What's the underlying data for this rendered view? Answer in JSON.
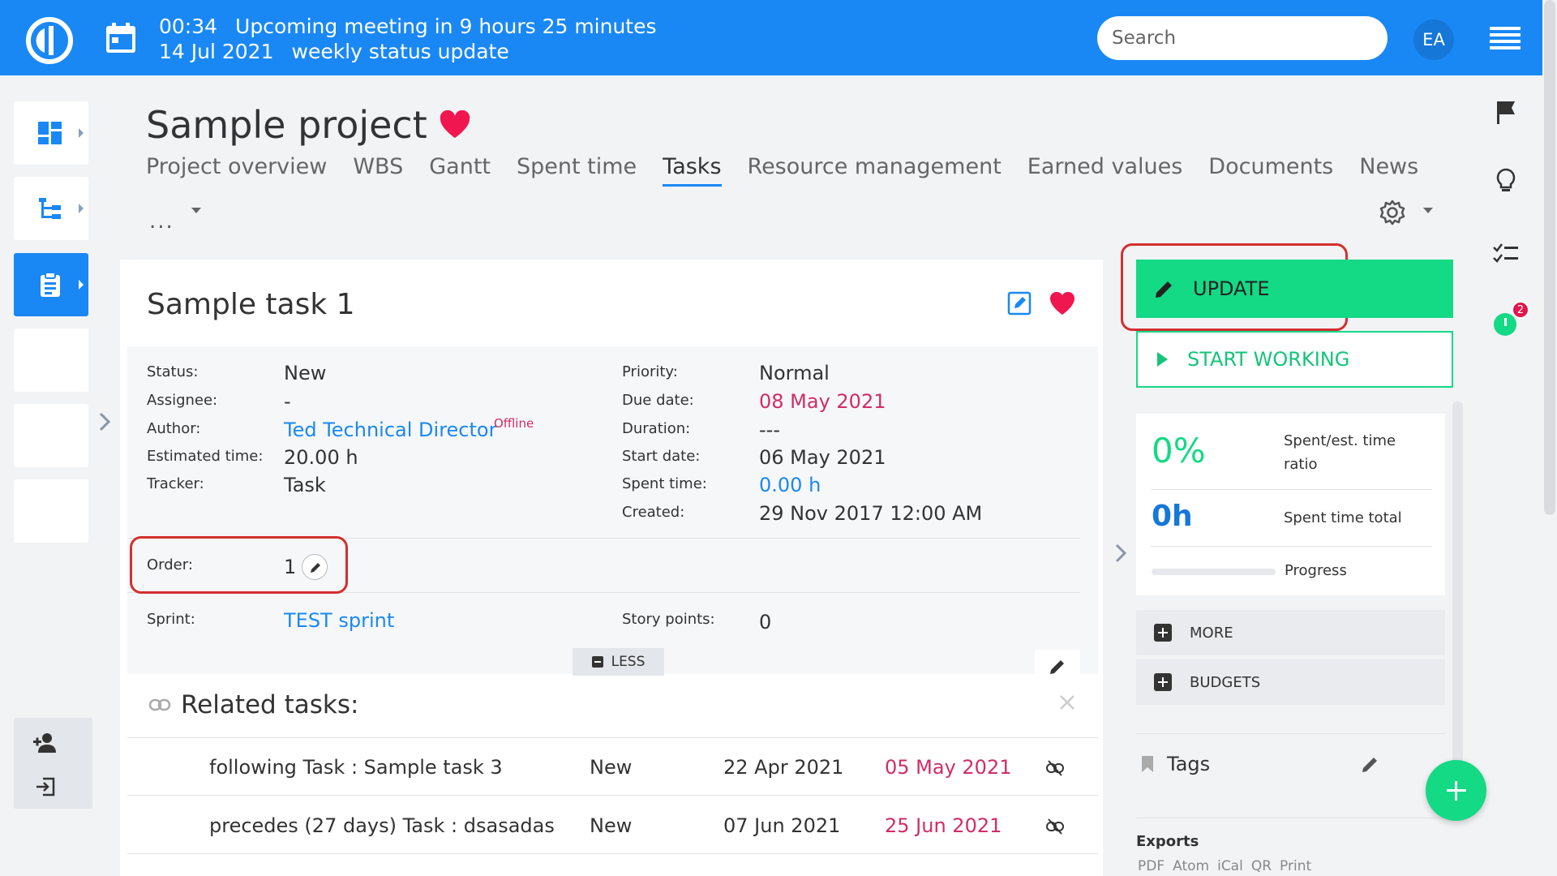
{
  "topbar": {
    "meeting_time": "00:34",
    "meeting_text": "Upcoming meeting in 9 hours 25 minutes",
    "meeting_date": "14 Jul 2021",
    "meeting_title": "weekly status update",
    "search_placeholder": "Search",
    "avatar_initials": "EA"
  },
  "project": {
    "title": "Sample project",
    "tabs": [
      "Project overview",
      "WBS",
      "Gantt",
      "Spent time",
      "Tasks",
      "Resource management",
      "Earned values",
      "Documents",
      "News"
    ],
    "active_tab": "Tasks",
    "more_label": "..."
  },
  "task": {
    "title": "Sample task 1",
    "left_attrs": [
      {
        "label": "Status:",
        "value": "New"
      },
      {
        "label": "Assignee:",
        "value": "-"
      },
      {
        "label": "Author:",
        "value": "Ted Technical Director"
      },
      {
        "label": "Estimated time:",
        "value": "20.00 h"
      },
      {
        "label": "Tracker:",
        "value": "Task"
      }
    ],
    "author_status": "Offline",
    "right_attrs": [
      {
        "label": "Priority:",
        "value": "Normal"
      },
      {
        "label": "Due date:",
        "value": "08 May 2021"
      },
      {
        "label": "Duration:",
        "value": "---"
      },
      {
        "label": "Start date:",
        "value": "06 May 2021"
      },
      {
        "label": "Spent time:",
        "value": "0.00 h"
      },
      {
        "label": "Created:",
        "value": "29 Nov 2017 12:00 AM"
      }
    ],
    "order": {
      "label": "Order:",
      "value": "1"
    },
    "sprint": {
      "label": "Sprint:",
      "value": "TEST sprint"
    },
    "story_points": {
      "label": "Story points:",
      "value": "0"
    },
    "less_label": "LESS"
  },
  "related": {
    "title": "Related tasks:",
    "rows": [
      {
        "name": "following Task : Sample task 3",
        "status": "New",
        "start": "22 Apr 2021",
        "due": "05 May 2021"
      },
      {
        "name": "precedes (27 days) Task : dsasadas",
        "status": "New",
        "start": "07 Jun 2021",
        "due": "25 Jun 2021"
      }
    ]
  },
  "sidebar_right": {
    "update_label": "UPDATE",
    "start_label": "START WORKING",
    "ratio_value": "0%",
    "ratio_label": "Spent/est. time ratio",
    "total_value": "0h",
    "total_label": "Spent time total",
    "progress_label": "Progress",
    "progress_fraction": 0,
    "more_label": "MORE",
    "budgets_label": "BUDGETS",
    "tags_label": "Tags",
    "exports_title": "Exports",
    "exports": [
      "PDF",
      "Atom",
      "iCal",
      "QR",
      "Print"
    ]
  },
  "notifications": {
    "timer_badge": "2"
  },
  "colors": {
    "brand": "#1a88f4",
    "accent_green": "#14d985",
    "date_red": "#d12d65",
    "highlight_box": "#d32f2f"
  }
}
